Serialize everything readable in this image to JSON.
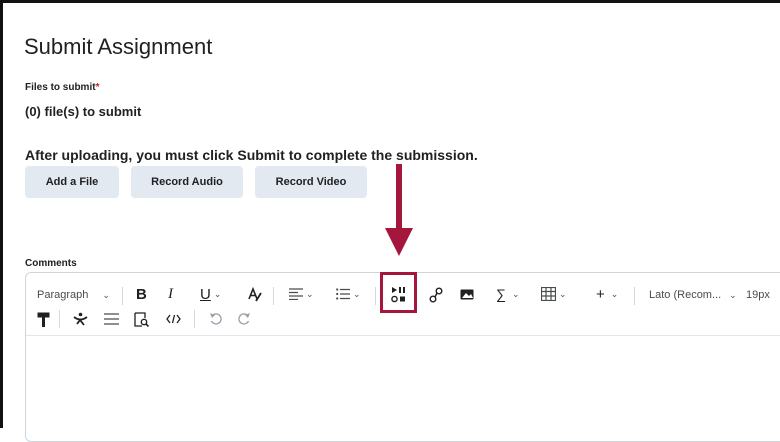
{
  "page": {
    "title": "Submit Assignment",
    "files_label": "Files to submit",
    "required_marker": "*",
    "files_count": "(0) file(s) to submit",
    "upload_note": "After uploading, you must click Submit to complete the submission."
  },
  "buttons": {
    "add_file": "Add a File",
    "record_audio": "Record Audio",
    "record_video": "Record Video"
  },
  "comments": {
    "label": "Comments"
  },
  "toolbar": {
    "paragraph": "Paragraph",
    "bold": "B",
    "italic": "I",
    "underline": "U",
    "sum": "∑",
    "add": "+",
    "font": "Lato (Recom...",
    "font_size": "19px"
  },
  "colors": {
    "highlight": "#a4163b",
    "button_bg": "#e3e9f1",
    "required": "#cd2026"
  }
}
